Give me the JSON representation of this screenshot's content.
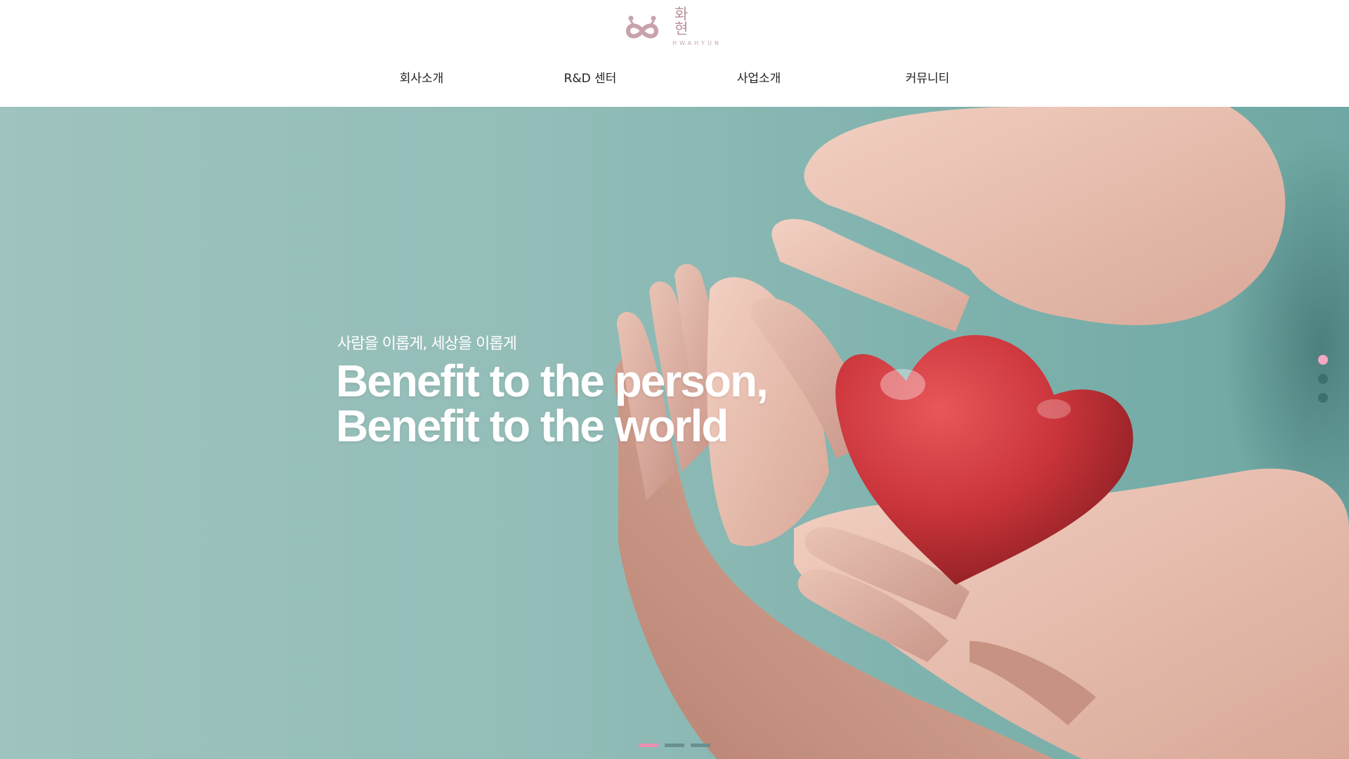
{
  "brand": {
    "name_ko": "화 현",
    "name_en": "HWAHYUN"
  },
  "nav": [
    {
      "label": "회사소개"
    },
    {
      "label": "R&D 센터"
    },
    {
      "label": "사업소개"
    },
    {
      "label": "커뮤니티"
    }
  ],
  "hero": {
    "subtitle": "사람을 이롭게, 세상을 이롭게",
    "title_line1": "Benefit to the person,",
    "title_line2": "Benefit to the world",
    "slide_count": 3,
    "active_slide": 1
  },
  "colors": {
    "accent_pink": "#ee8fb0",
    "logo_color": "#b88f98",
    "hero_bg": "#93bdb8"
  }
}
